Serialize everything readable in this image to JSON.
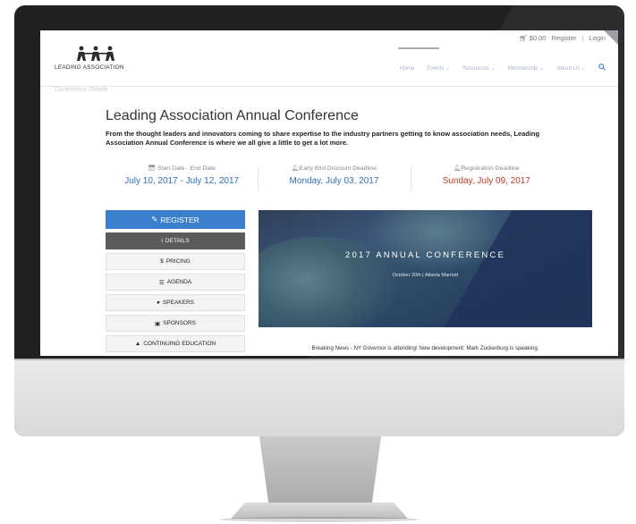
{
  "topbar": {
    "cart": "$0.00",
    "register": "Register",
    "separator": "|",
    "login": "Login",
    "badge": "+"
  },
  "logo": {
    "text": "LEADING ASSOCIATION"
  },
  "nav": {
    "items": [
      "Home",
      "Events ⌄",
      "Resources ⌄",
      "Membership ⌄",
      "About Us ⌄"
    ],
    "search_icon": "search-icon"
  },
  "breadcrumb": "Conference Details",
  "event": {
    "title": "Leading Association Annual Conference",
    "intro": "From the thought leaders and innovators coming to share expertise to the industry partners getting to know association needs, Leading Association Annual Conference is where we all give a little to get a lot more."
  },
  "dates": [
    {
      "icon": "calendar-icon",
      "label": "Start Date - End Date",
      "value": "July 10, 2017 - July 12, 2017"
    },
    {
      "icon": "bell-icon",
      "label": "Early Bird Discount Deadline",
      "value": "Monday, July 03, 2017"
    },
    {
      "icon": "bell-icon",
      "label": "Registration Deadline",
      "value": "Sunday, July 09, 2017"
    }
  ],
  "sidebar": {
    "register": "REGISTER",
    "items": [
      "DETAILS",
      "PRICING",
      "AGENDA",
      "SPEAKERS",
      "SPONSORS",
      "CONTINUING EDUCATION"
    ]
  },
  "banner": {
    "title": "2017 ANNUAL CONFERENCE",
    "subtitle": "October 20th | Atlanta Marriott"
  },
  "news": "Breaking News - NY Governor is attending! New development: Mark Zuckerburg is speaking.",
  "colors": {
    "accent": "#3a80cc",
    "link_blue": "#2f6db5",
    "deadline_red": "#c0392b",
    "dark_tab": "#5a5b5d"
  }
}
